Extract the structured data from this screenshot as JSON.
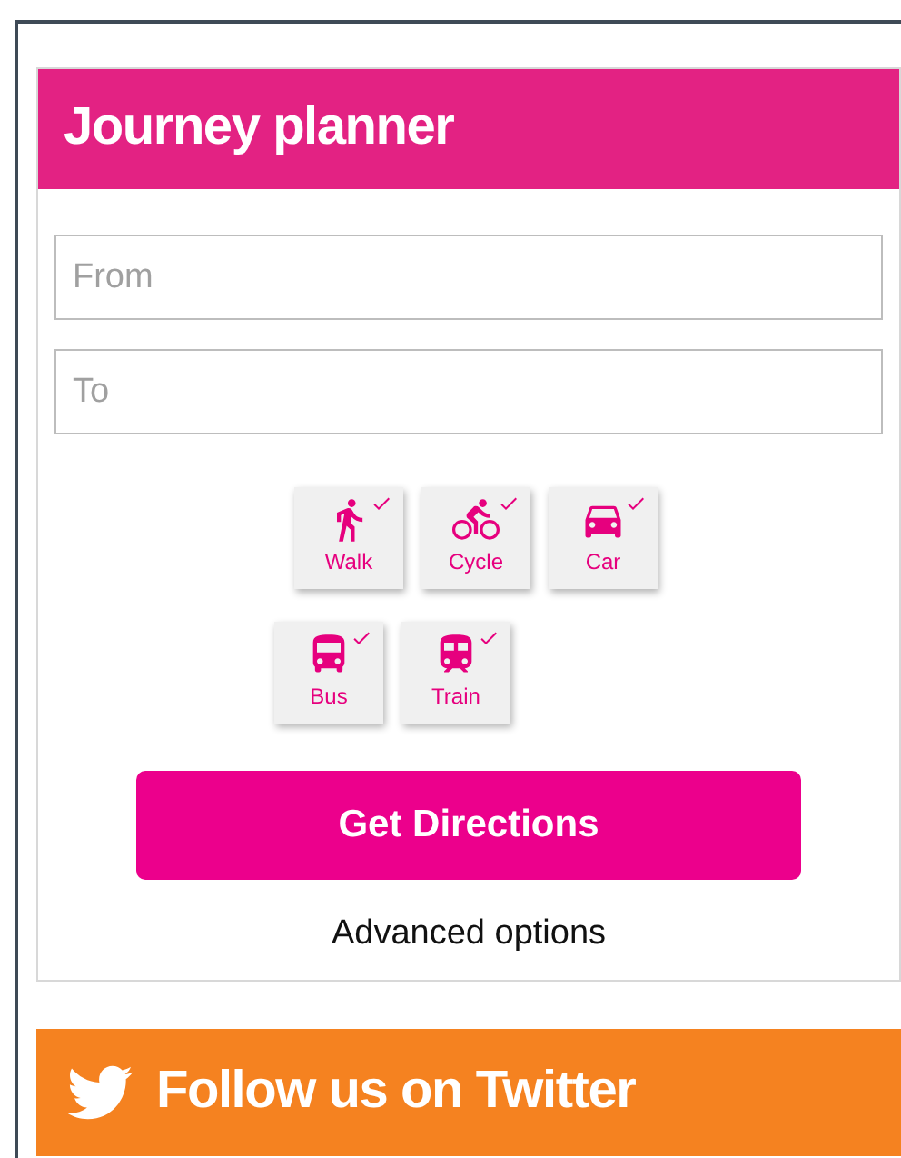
{
  "planner": {
    "title": "Journey planner",
    "from": {
      "placeholder": "From"
    },
    "to": {
      "placeholder": "To"
    },
    "modes": [
      {
        "kind": "walk",
        "label": "Walk",
        "selected": true
      },
      {
        "kind": "cycle",
        "label": "Cycle",
        "selected": true
      },
      {
        "kind": "car",
        "label": "Car",
        "selected": true
      },
      {
        "kind": "bus",
        "label": "Bus",
        "selected": true
      },
      {
        "kind": "train",
        "label": "Train",
        "selected": true
      }
    ],
    "submit": "Get Directions",
    "advanced": "Advanced options"
  },
  "twitter": {
    "title": "Follow us on Twitter"
  }
}
